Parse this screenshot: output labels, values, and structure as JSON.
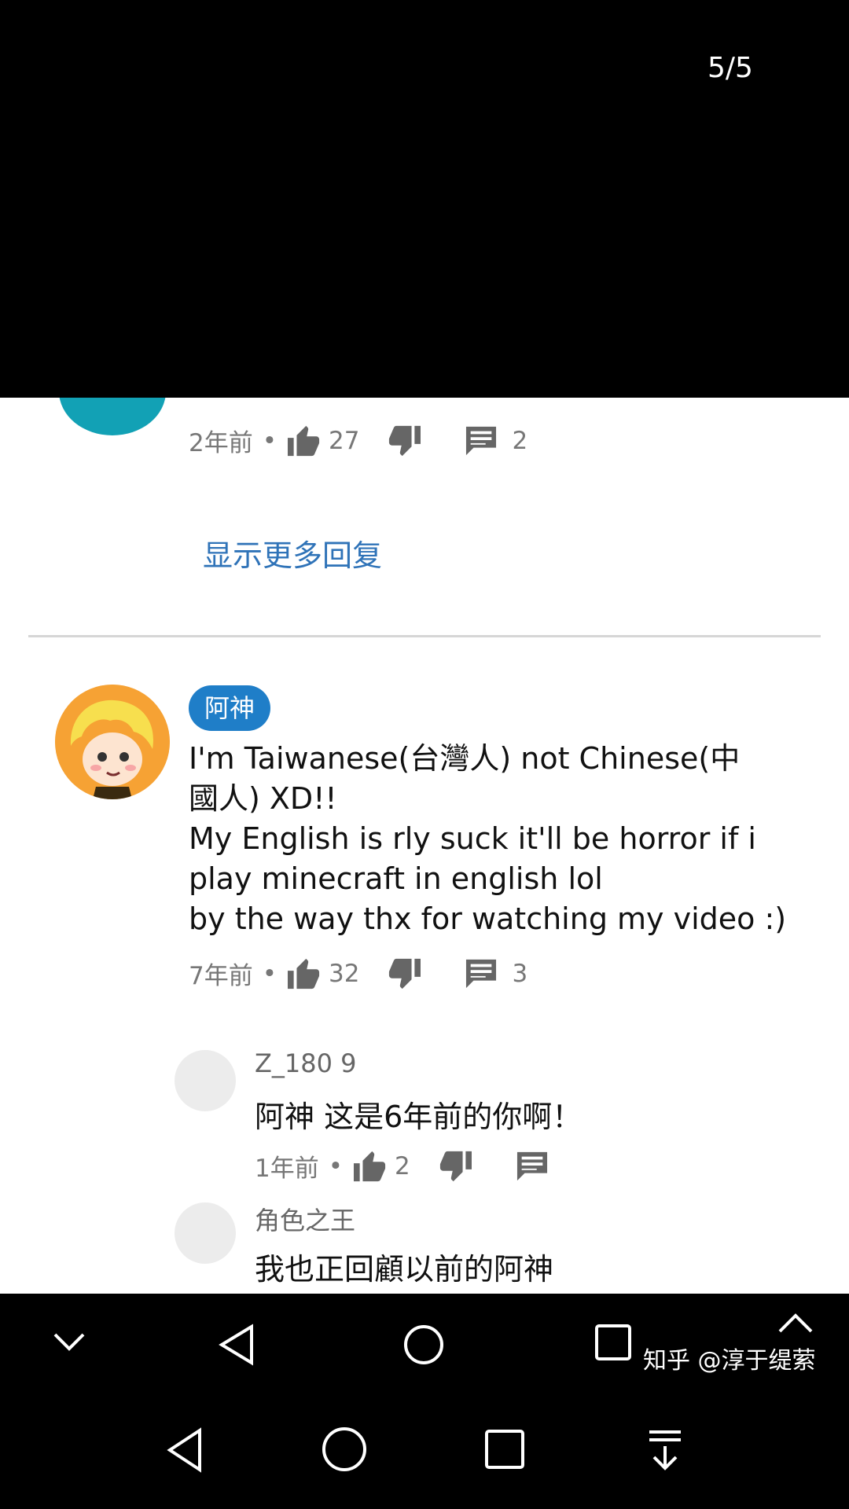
{
  "viewer": {
    "counter": "5/5"
  },
  "top_comment": {
    "time": "2年前",
    "likes": "27",
    "replies": "2"
  },
  "show_more_replies": "显示更多回复",
  "main_comment": {
    "author_badge": "阿神",
    "text_lines": [
      "I'm Taiwanese(台灣人) not Chinese(中",
      "國人) XD!!",
      "My English is rly suck it'll be horror if i",
      "play minecraft in english lol",
      "by the way thx for watching my video :)"
    ],
    "time": "7年前",
    "likes": "32",
    "replies": "3"
  },
  "replies": [
    {
      "name": "Z_180 9",
      "text": "阿神 这是6年前的你啊！",
      "time": "1年前",
      "likes": "2"
    },
    {
      "name": "角色之王",
      "text": "我也正回顧以前的阿神"
    }
  ],
  "watermark": "知乎 @淳于缇萦",
  "icons": {
    "like": "thumb-up-icon",
    "dislike": "thumb-down-icon",
    "reply": "comment-icon",
    "nav": [
      "chevron-down-icon",
      "back-icon",
      "home-icon",
      "recents-icon",
      "chevron-up-icon",
      "back-icon",
      "home-icon",
      "recents-icon",
      "download-icon"
    ]
  },
  "colors": {
    "link": "#2f73b8",
    "badge": "#1f7ec8",
    "top_avatar": "#12a1b5",
    "main_avatar": "#f6a234"
  }
}
